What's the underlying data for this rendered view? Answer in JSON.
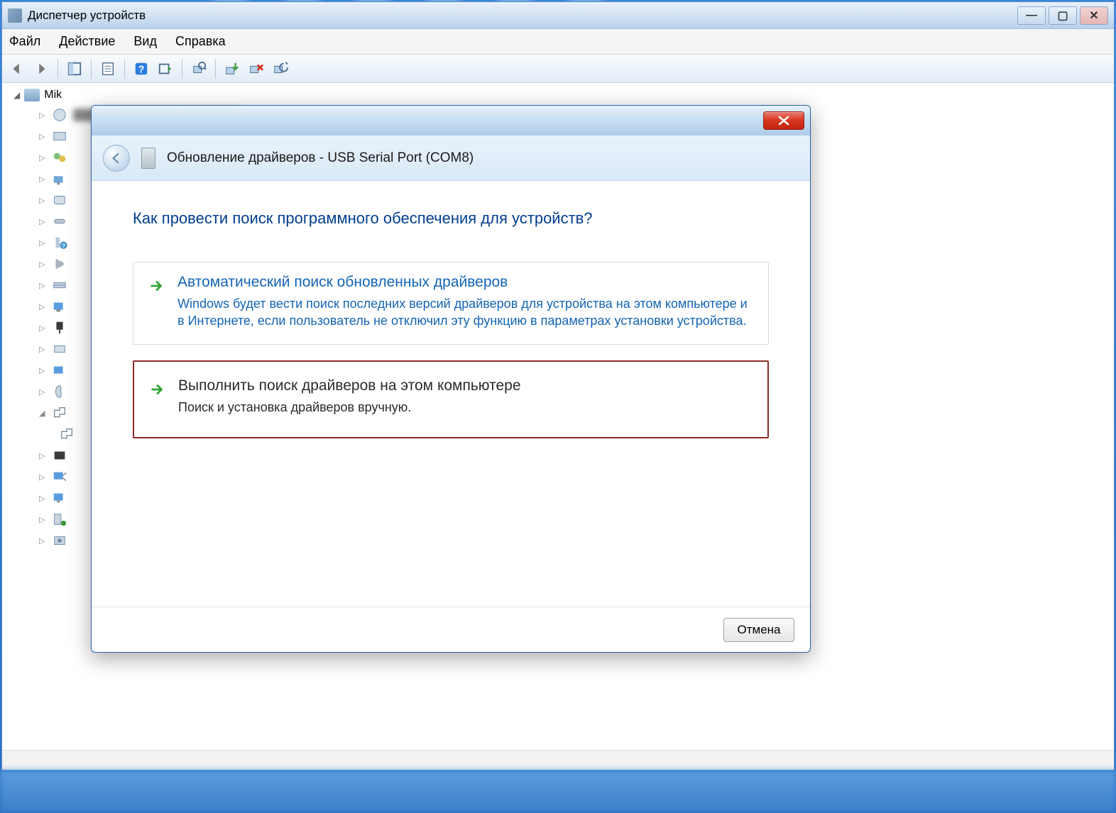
{
  "window": {
    "title": "Диспетчер устройств"
  },
  "menubar": {
    "file": "Файл",
    "action": "Действие",
    "view": "Вид",
    "help": "Справка"
  },
  "tree": {
    "root": "Mik"
  },
  "dialog": {
    "title": "Обновление драйверов - USB Serial Port (COM8)",
    "question": "Как провести поиск программного обеспечения для устройств?",
    "option1": {
      "title": "Автоматический поиск обновленных драйверов",
      "desc": "Windows будет вести поиск последних версий драйверов для устройства на этом компьютере и в Интернете, если пользователь не отключил эту функцию в параметрах установки устройства."
    },
    "option2": {
      "title": "Выполнить поиск драйверов на этом компьютере",
      "desc": "Поиск и установка драйверов вручную."
    },
    "cancel": "Отмена"
  }
}
